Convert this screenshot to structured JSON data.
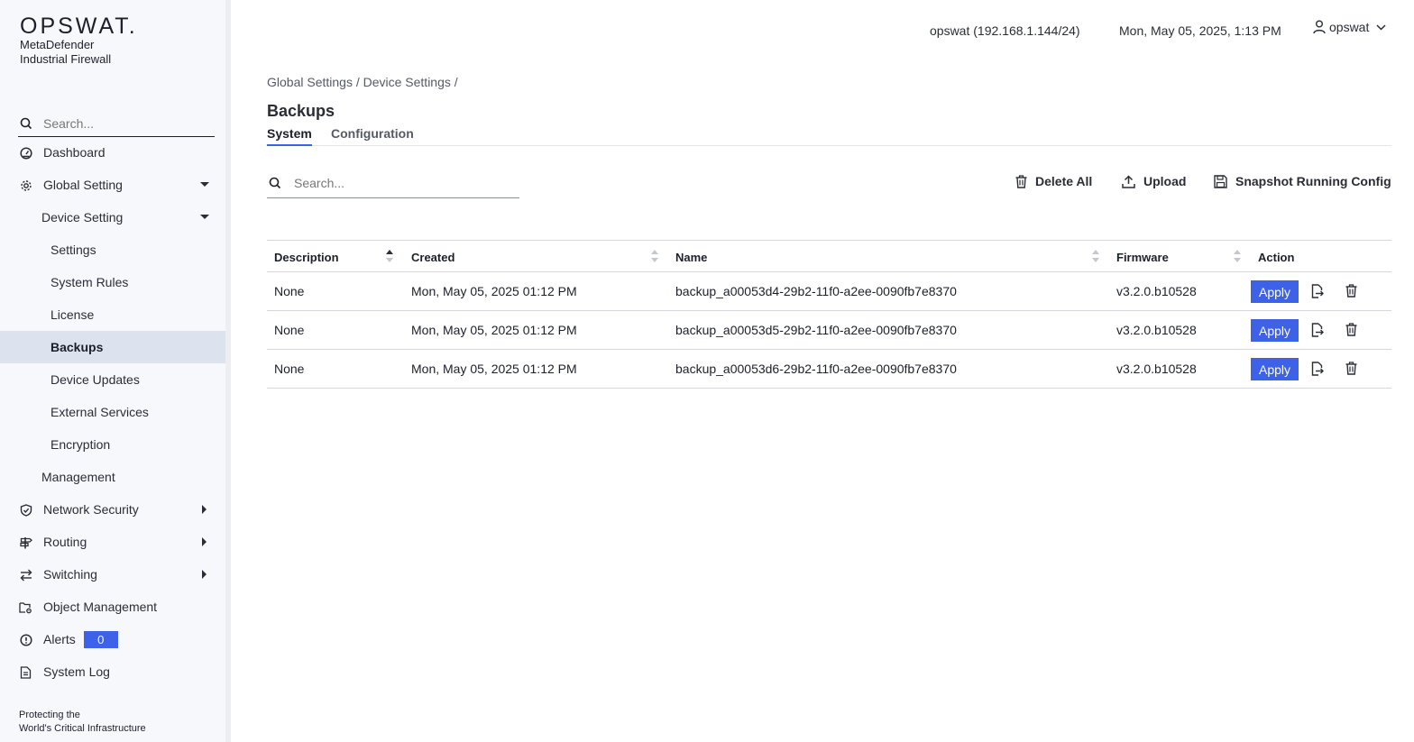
{
  "brand": {
    "logo": "OPSWAT.",
    "product_line1": "MetaDefender",
    "product_line2": "Industrial Firewall",
    "tagline_line1": "Protecting the",
    "tagline_line2": "World's Critical Infrastructure"
  },
  "sidebar": {
    "search_placeholder": "Search...",
    "items": [
      {
        "label": "Dashboard",
        "icon": "dashboard-icon"
      },
      {
        "label": "Global Setting",
        "icon": "gear-icon",
        "caret": "down"
      },
      {
        "label": "Device Setting",
        "caret": "down"
      },
      {
        "label": "Settings"
      },
      {
        "label": "System Rules"
      },
      {
        "label": "License"
      },
      {
        "label": "Backups",
        "active": true
      },
      {
        "label": "Device Updates"
      },
      {
        "label": "External Services"
      },
      {
        "label": "Encryption"
      },
      {
        "label": "Management"
      },
      {
        "label": "Network Security",
        "icon": "shield-icon",
        "caret": "right"
      },
      {
        "label": "Routing",
        "icon": "signpost-icon",
        "caret": "right"
      },
      {
        "label": "Switching",
        "icon": "swap-arrows-icon",
        "caret": "right"
      },
      {
        "label": "Object Management",
        "icon": "folder-gear-icon"
      },
      {
        "label": "Alerts",
        "icon": "alert-circle-icon",
        "badge": "0"
      },
      {
        "label": "System Log",
        "icon": "log-file-icon"
      }
    ]
  },
  "header": {
    "host": "opswat (192.168.1.144/24)",
    "datetime": "Mon, May 05, 2025, 1:13 PM",
    "user": "opswat"
  },
  "page": {
    "breadcrumb": "Global Settings / Device Settings /",
    "title": "Backups",
    "tabs": [
      {
        "label": "System",
        "active": true
      },
      {
        "label": "Configuration",
        "active": false
      }
    ],
    "search_placeholder": "Search...",
    "toolbar": {
      "delete_all": "Delete All",
      "upload": "Upload",
      "snapshot": "Snapshot Running Config"
    }
  },
  "table": {
    "columns": [
      "Description",
      "Created",
      "Name",
      "Firmware",
      "Action"
    ],
    "rows": [
      {
        "description": "None",
        "created": "Mon, May 05, 2025 01:12 PM",
        "name": "backup_a00053d4-29b2-11f0-a2ee-0090fb7e8370",
        "firmware": "v3.2.0.b10528",
        "apply": "Apply"
      },
      {
        "description": "None",
        "created": "Mon, May 05, 2025 01:12 PM",
        "name": "backup_a00053d5-29b2-11f0-a2ee-0090fb7e8370",
        "firmware": "v3.2.0.b10528",
        "apply": "Apply"
      },
      {
        "description": "None",
        "created": "Mon, May 05, 2025 01:12 PM",
        "name": "backup_a00053d6-29b2-11f0-a2ee-0090fb7e8370",
        "firmware": "v3.2.0.b10528",
        "apply": "Apply"
      }
    ]
  },
  "colors": {
    "accent": "#3d62e8",
    "sidebar_bg": "#f7f8fb",
    "active_item_bg": "#dde2ef"
  }
}
